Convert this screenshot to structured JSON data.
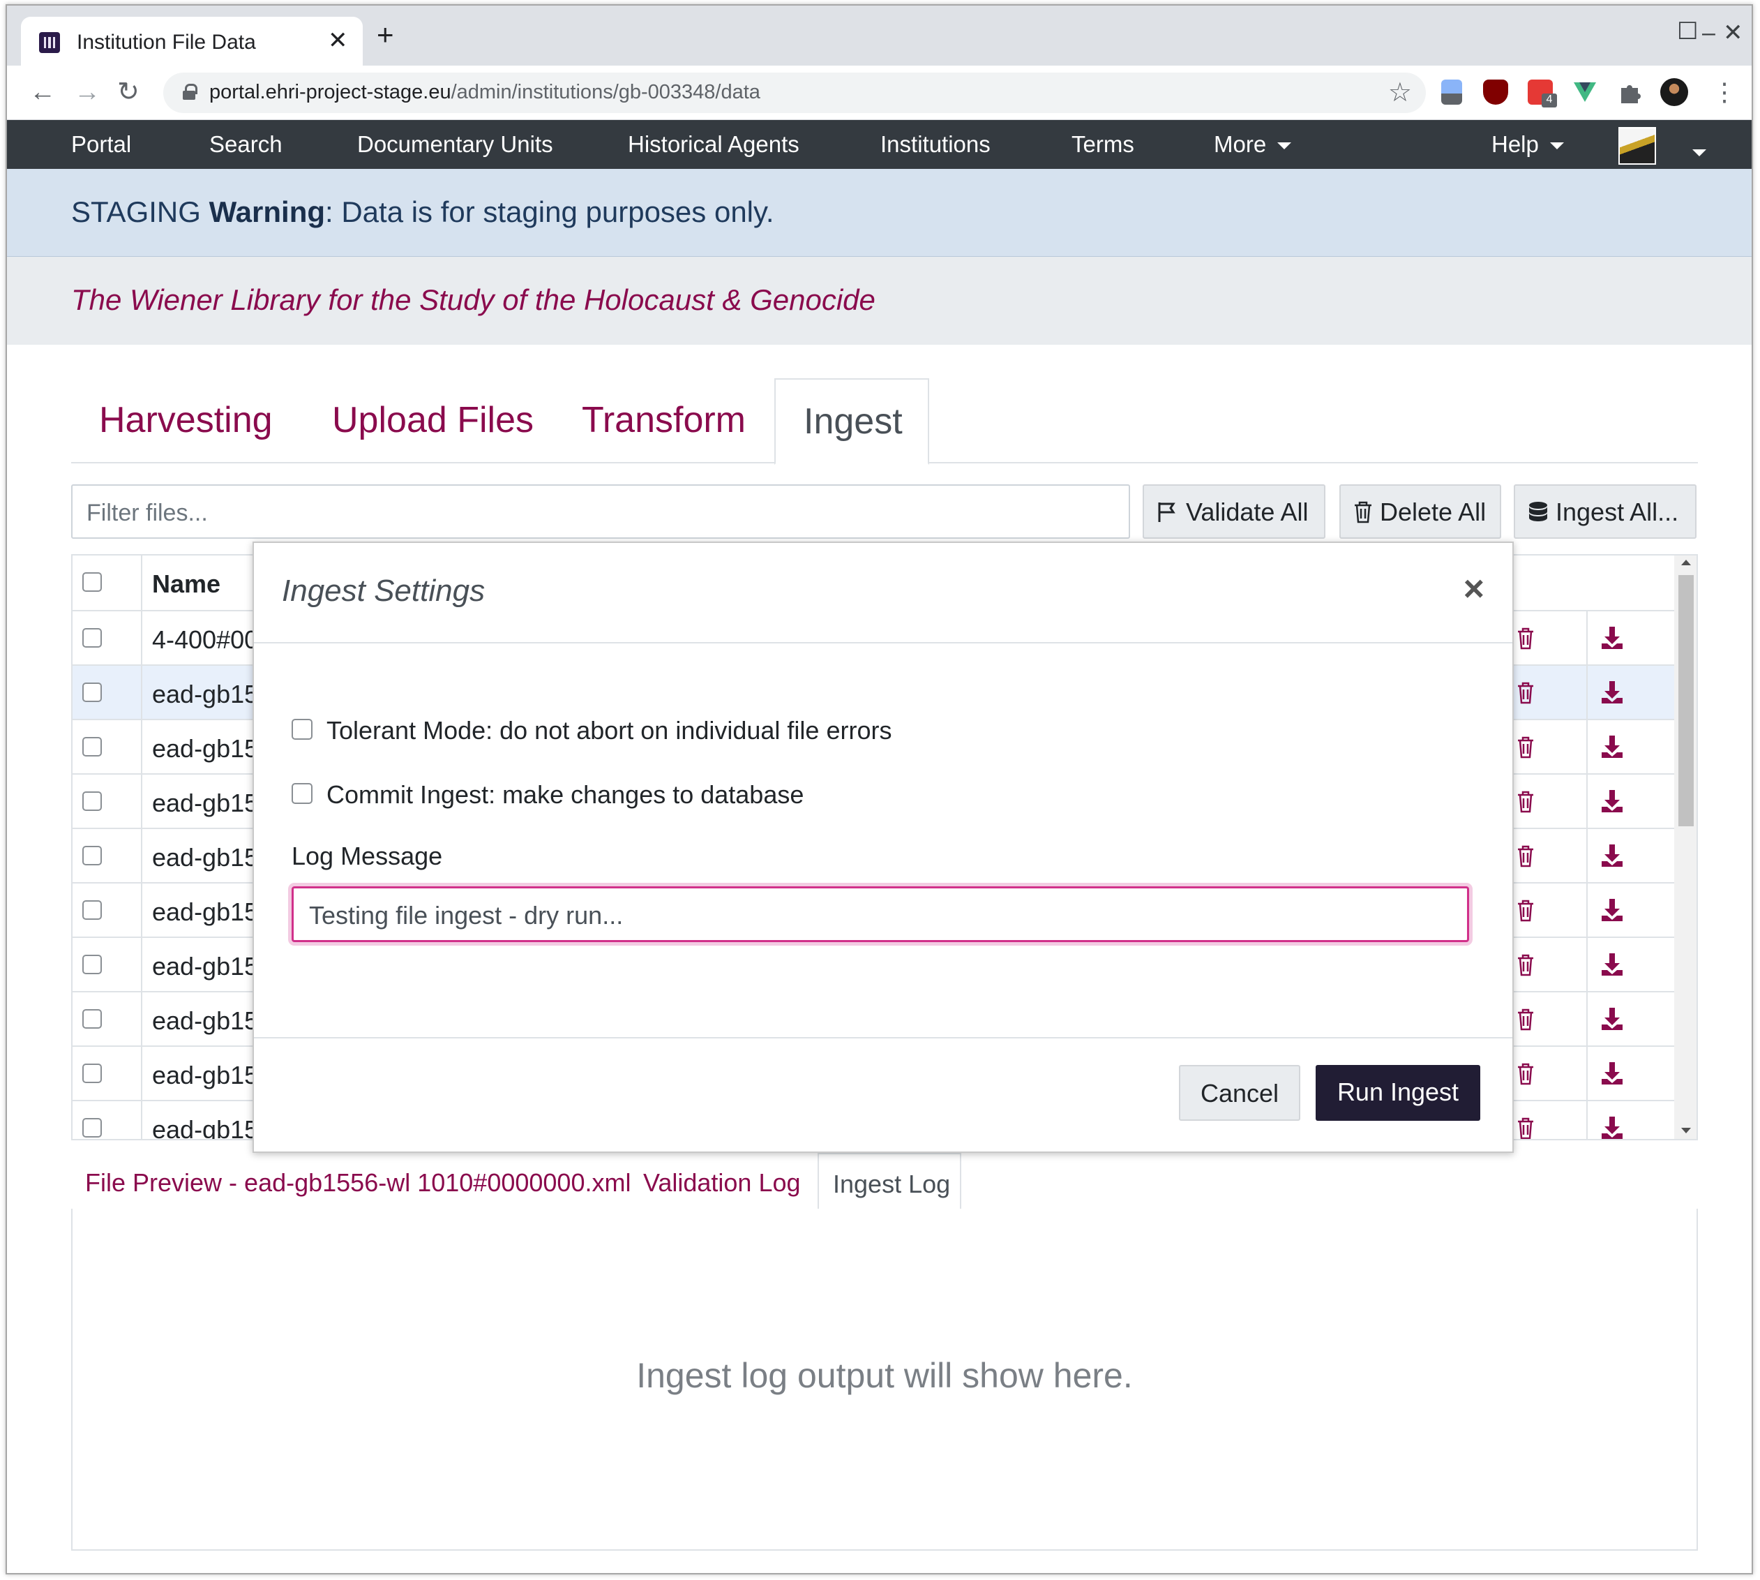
{
  "browser": {
    "tab_title": "Institution File Data",
    "url_host": "portal.ehri-project-stage.eu",
    "url_path": "/admin/institutions/gb-003348/data",
    "extension_badge": "4"
  },
  "nav": {
    "items": [
      "Portal",
      "Search",
      "Documentary Units",
      "Historical Agents",
      "Institutions",
      "Terms",
      "More",
      "Help"
    ]
  },
  "staging": {
    "prefix": "STAGING ",
    "bold": "Warning",
    "suffix": ": Data is for staging purposes only."
  },
  "institution": {
    "name": "The Wiener Library for the Study of the Holocaust & Genocide"
  },
  "tabs": [
    "Harvesting",
    "Upload Files",
    "Transform",
    "Ingest"
  ],
  "filter": {
    "placeholder": "Filter files..."
  },
  "buttons": {
    "validate_all": "Validate All",
    "delete_all": "Delete All",
    "ingest_all": "Ingest All..."
  },
  "table": {
    "header_name": "Name",
    "rows": [
      "4-400#00",
      "ead-gb15",
      "ead-gb15",
      "ead-gb15",
      "ead-gb15",
      "ead-gb15",
      "ead-gb15",
      "ead-gb15",
      "ead-gb15",
      "ead-gb15"
    ]
  },
  "bottom_tabs": {
    "preview": "File Preview - ead-gb1556-wl 1010#0000000.xml",
    "validation": "Validation Log",
    "ingest": "Ingest Log"
  },
  "log_placeholder": "Ingest log output will show here.",
  "modal": {
    "title": "Ingest Settings",
    "close": "×",
    "tolerant": "Tolerant Mode: do not abort on individual file errors",
    "commit": "Commit Ingest: make changes to database",
    "log_label": "Log Message",
    "log_value": "Testing file ingest - dry run...",
    "cancel": "Cancel",
    "run": "Run Ingest"
  },
  "colors": {
    "brand": "#8a0b4d",
    "navbar": "#343a40",
    "staging_bg": "#d6e2ef",
    "primary_button": "#211d34"
  }
}
